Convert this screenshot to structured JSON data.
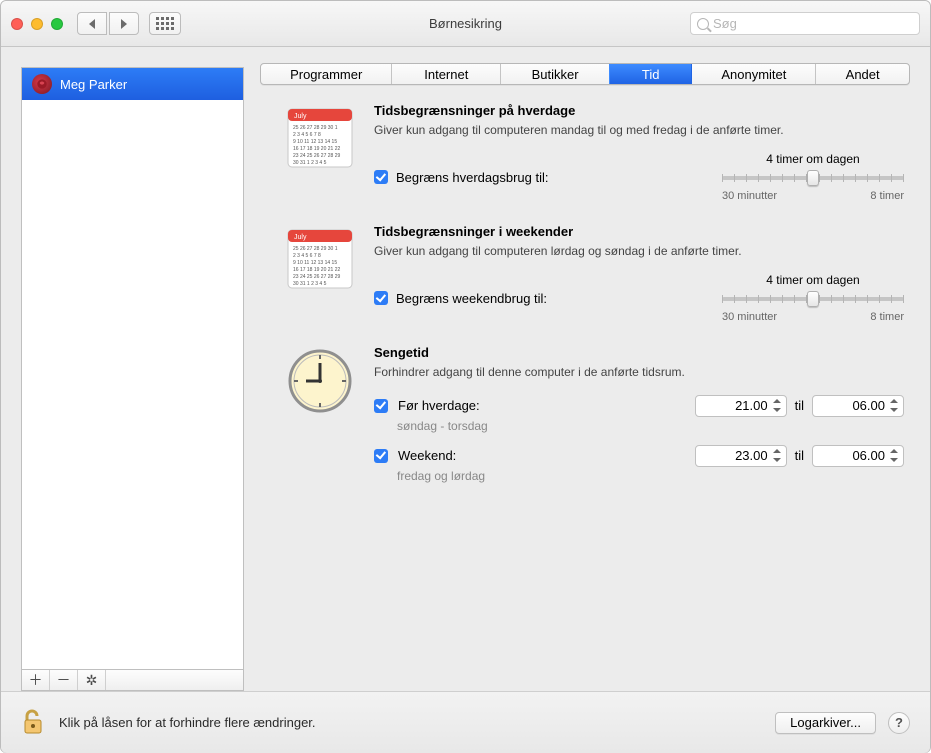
{
  "title": "Børnesikring",
  "search_placeholder": "Søg",
  "sidebar": {
    "users": [
      {
        "name": "Meg Parker"
      }
    ]
  },
  "tabs": [
    "Programmer",
    "Internet",
    "Butikker",
    "Tid",
    "Anonymitet",
    "Andet"
  ],
  "active_tab_index": 3,
  "weekday": {
    "title": "Tidsbegrænsninger på hverdage",
    "desc": "Giver kun adgang til computeren mandag til og med fredag i de anførte timer.",
    "checkbox_label": "Begræns hverdagsbrug til:",
    "value_label": "4 timer om dagen",
    "min_label": "30 minutter",
    "max_label": "8 timer"
  },
  "weekend": {
    "title": "Tidsbegrænsninger i weekender",
    "desc": "Giver kun adgang til computeren lørdag og søndag i de anførte timer.",
    "checkbox_label": "Begræns weekendbrug til:",
    "value_label": "4 timer om dagen",
    "min_label": "30 minutter",
    "max_label": "8 timer"
  },
  "bedtime": {
    "title": "Sengetid",
    "desc": "Forhindrer adgang til denne computer i de anførte tidsrum.",
    "school_label": "Før hverdage:",
    "school_sub": "søndag - torsdag",
    "school_from": "21.00",
    "school_to": "06.00",
    "weekend_label": "Weekend:",
    "weekend_sub": "fredag og lørdag",
    "weekend_from": "23.00",
    "weekend_to": "06.00",
    "til": "til"
  },
  "footer": {
    "lock_text": "Klik på låsen for at forhindre flere ændringer.",
    "logs_button": "Logarkiver..."
  }
}
